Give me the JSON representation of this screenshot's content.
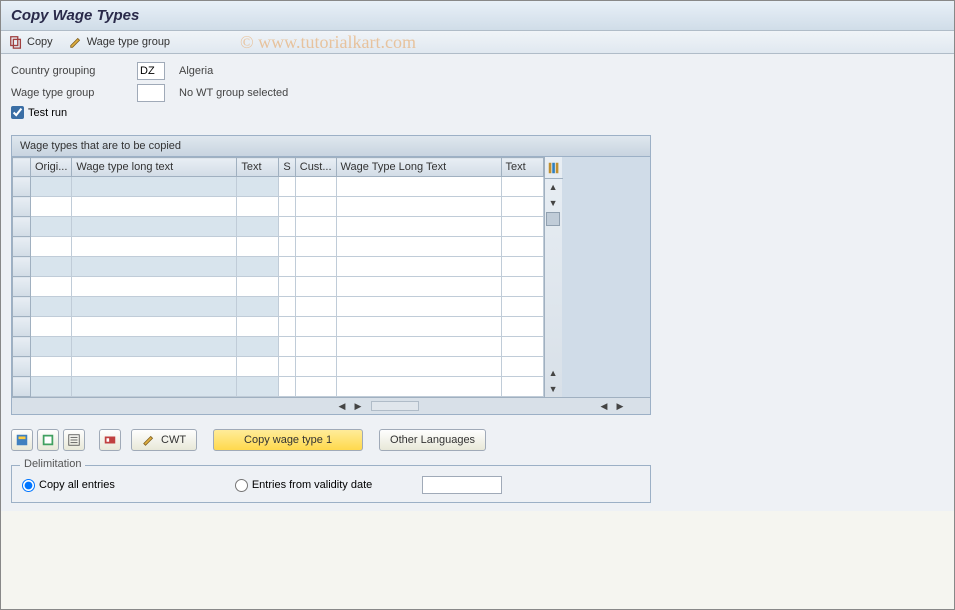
{
  "header": {
    "title": "Copy Wage Types"
  },
  "toolbar": {
    "copy_label": "Copy",
    "wage_type_group_label": "Wage type group"
  },
  "form": {
    "country_grouping_label": "Country grouping",
    "country_grouping_value": "DZ",
    "country_name": "Algeria",
    "wage_type_group_label": "Wage type group",
    "wage_type_group_value": "",
    "wage_type_group_text": "No WT group selected",
    "test_run_label": "Test run",
    "test_run_checked": true
  },
  "table": {
    "title": "Wage types that are to be copied",
    "columns": {
      "origi": "Origi...",
      "wtlt": "Wage type long text",
      "text": "Text",
      "s": "S",
      "cust": "Cust...",
      "wtlt2": "Wage Type Long Text",
      "text2": "Text"
    },
    "rows": 11
  },
  "buttons": {
    "cwt": "CWT",
    "copy_wage_type_1": "Copy wage type 1",
    "other_languages": "Other Languages"
  },
  "delimitation": {
    "title": "Delimitation",
    "copy_all": "Copy all entries",
    "entries_from": "Entries from validity date",
    "date_value": ""
  },
  "watermark": "© www.tutorialkart.com"
}
